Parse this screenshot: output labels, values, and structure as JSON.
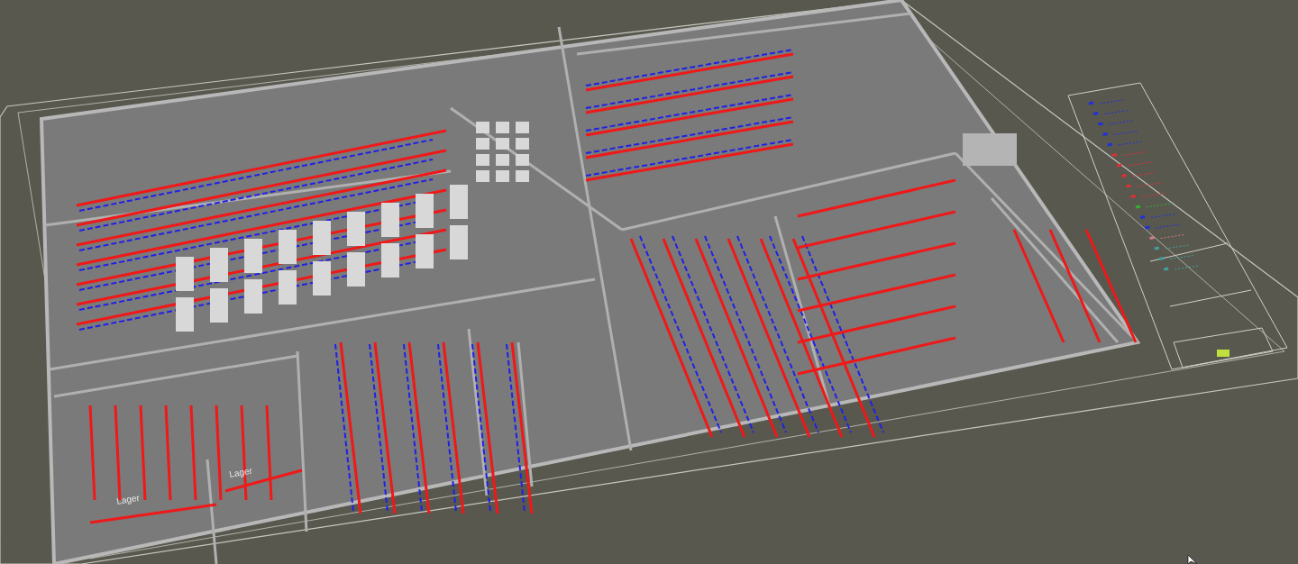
{
  "viewport": {
    "labels": [
      {
        "text": "Lager"
      },
      {
        "text": "Lager"
      }
    ]
  }
}
